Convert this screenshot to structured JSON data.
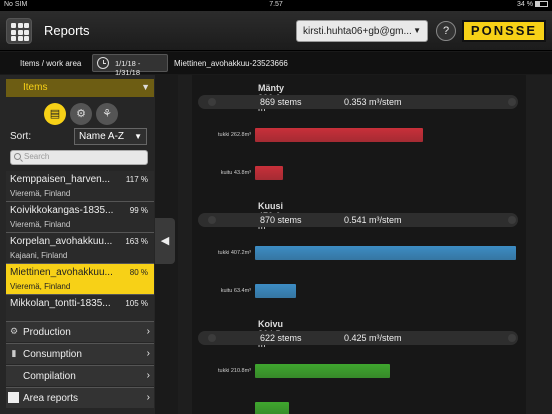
{
  "status": {
    "carrier": "No SIM",
    "time": "7.57",
    "battery": "34 %",
    "battery_level": 0.34
  },
  "header": {
    "menu_icon": "grid-icon",
    "title": "Reports",
    "user": "kirsti.huhta06+gb@gm...",
    "help": "?",
    "logo": "PONSSE"
  },
  "crumb": {
    "label": "Items / work area",
    "date_range": "1/1/18 - 1/31/18",
    "area": "Miettinen_avohakkuu-23523666"
  },
  "sidebar": {
    "items_header": "Items",
    "type_icons": [
      {
        "name": "stack-icon",
        "glyph": "▤",
        "active": true
      },
      {
        "name": "machine-icon",
        "glyph": "⚙",
        "active": false
      },
      {
        "name": "tree-icon",
        "glyph": "⚘",
        "active": false
      }
    ],
    "sort_label": "Sort:",
    "sort_value": "Name A-Z",
    "search_placeholder": "Search",
    "items": [
      {
        "name": "Kemppaisen_harven...",
        "pct": "117 %",
        "loc": "Vieremä, Finland",
        "selected": false
      },
      {
        "name": "Koivikkokangas-1835...",
        "pct": "99 %",
        "loc": "Vieremä, Finland",
        "selected": false
      },
      {
        "name": "Korpelan_avohakkuu...",
        "pct": "163 %",
        "loc": "Kajaani, Finland",
        "selected": false
      },
      {
        "name": "Miettinen_avohakkuu...",
        "pct": "80 %",
        "loc": "Vieremä, Finland",
        "selected": true
      },
      {
        "name": "Mikkolan_tontti-1835...",
        "pct": "105 %",
        "loc": "",
        "selected": false
      }
    ],
    "menus": [
      {
        "label": "Production",
        "icon": "production-icon"
      },
      {
        "label": "Consumption",
        "icon": "fuel-icon"
      },
      {
        "label": "Compilation",
        "icon": ""
      },
      {
        "label": "Area reports",
        "icon": "report-icon"
      }
    ]
  },
  "chart_data": {
    "type": "bar",
    "title": "",
    "xlabel": "",
    "ylabel": "",
    "xlim": [
      0,
      400
    ],
    "species": [
      {
        "name": "Mänty",
        "volume": "306.6 m³",
        "stems": "869 stems",
        "per_stem": "0.353 m³/stem",
        "bars": [
          {
            "label": "tukki 262.8m³",
            "value": 262.8,
            "color": "#c8303a"
          },
          {
            "label": "kuitu 43.8m³",
            "value": 43.8,
            "color": "#c8303a"
          }
        ]
      },
      {
        "name": "Kuusi",
        "volume": "470.6 m³",
        "stems": "870 stems",
        "per_stem": "0.541 m³/stem",
        "bars": [
          {
            "label": "tukki 407.2m³",
            "value": 407.2,
            "color": "#3d8dc4"
          },
          {
            "label": "kuitu 63.4m³",
            "value": 63.4,
            "color": "#3d8dc4"
          }
        ]
      },
      {
        "name": "Koivu",
        "volume": "264.5 m³",
        "stems": "622 stems",
        "per_stem": "0.425 m³/stem",
        "bars": [
          {
            "label": "tukki 210.8m³",
            "value": 210.8,
            "color": "#3fa62e"
          },
          {
            "label": "",
            "value": 53.7,
            "color": "#3fa62e"
          }
        ]
      }
    ]
  }
}
